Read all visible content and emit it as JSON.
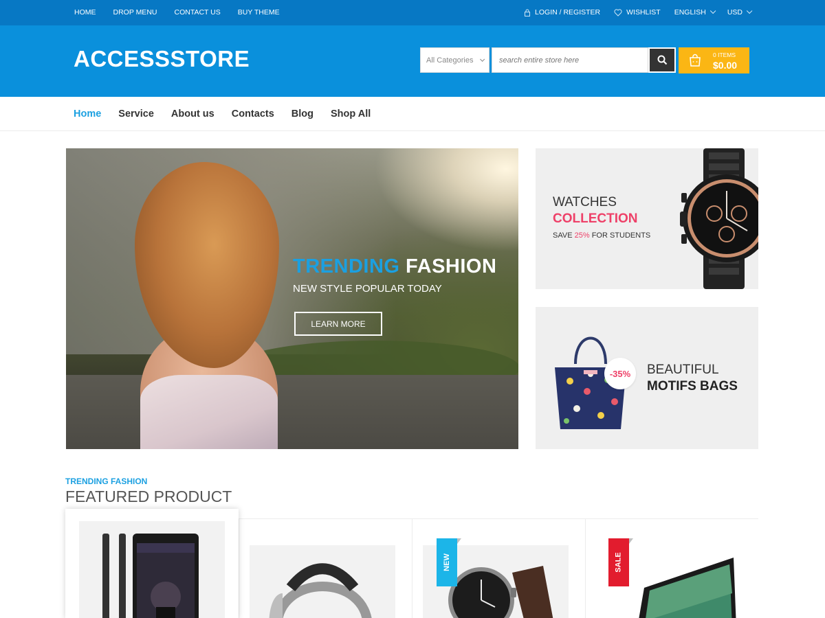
{
  "topbar": {
    "left_links": [
      "HOME",
      "DROP MENU",
      "CONTACT US",
      "BUY THEME"
    ],
    "login": "LOGIN / REGISTER",
    "wishlist": "WISHLIST",
    "language": "ENGLISH",
    "currency": "USD"
  },
  "header": {
    "logo": "ACCESSSTORE",
    "category": "All Categories",
    "search_placeholder": "search entire store here",
    "cart_items": "0 ITEMS",
    "cart_total": "$0.00"
  },
  "nav": {
    "items": [
      "Home",
      "Service",
      "About us",
      "Contacts",
      "Blog",
      "Shop All"
    ],
    "active": "Home"
  },
  "hero": {
    "title_part1": "TRENDING",
    "title_part2": "FASHION",
    "subtitle": "NEW STYLE POPULAR TODAY",
    "button": "LEARN MORE"
  },
  "promo_watches": {
    "line1": "WATCHES",
    "line2": "COLLECTION",
    "line3_prefix": "SAVE",
    "line3_pct": "25%",
    "line3_suffix": "FOR STUDENTS"
  },
  "promo_bags": {
    "badge": "-35%",
    "line1": "BEAUTIFUL",
    "line2": "MOTIFS BAGS"
  },
  "featured": {
    "subtitle": "TRENDING FASHION",
    "title": "FEATURED PRODUCT",
    "ribbons": [
      "NEW",
      "SALE"
    ]
  },
  "colors": {
    "topbar": "#0778c4",
    "header": "#0a90dc",
    "accent": "#1ba0e1",
    "cart": "#fbb614",
    "pink": "#ee4068",
    "new_ribbon": "#1cb5e8",
    "sale_ribbon": "#e21c2e"
  }
}
